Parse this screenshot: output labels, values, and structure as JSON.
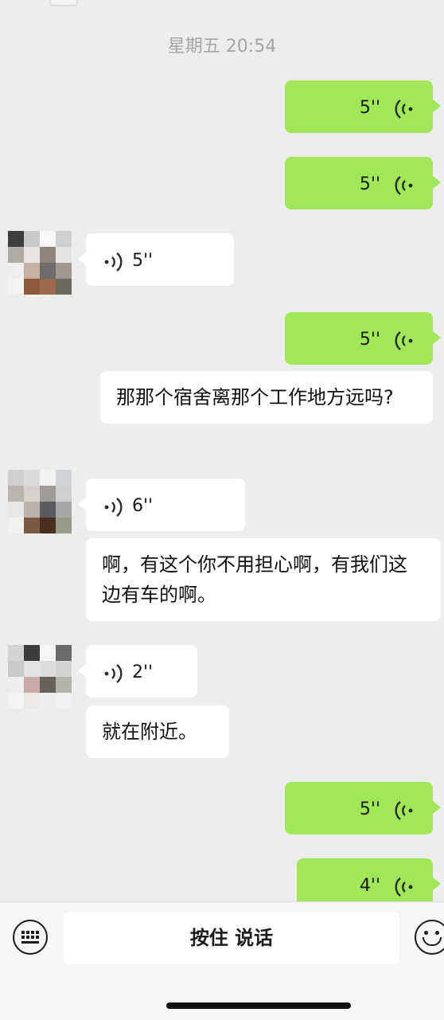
{
  "timestamp": "星期五 20:54",
  "colors": {
    "outgoing_bubble": "#a0e75a",
    "incoming_bubble": "#ffffff",
    "background": "#ededed"
  },
  "messages": [
    {
      "side": "out",
      "type": "voice",
      "duration": "5''"
    },
    {
      "side": "out",
      "type": "voice",
      "duration": "5''"
    },
    {
      "side": "in",
      "type": "voice",
      "duration": "5''"
    },
    {
      "side": "out",
      "type": "voice",
      "duration": "5''"
    },
    {
      "side": "in",
      "type": "text",
      "text": "那那个宿舍离那个工作地方远吗?"
    },
    {
      "side": "in",
      "type": "voice",
      "duration": "6''"
    },
    {
      "side": "in",
      "type": "text",
      "text": "啊，有这个你不用担心啊，有我们这边有车的啊。"
    },
    {
      "side": "in",
      "type": "voice",
      "duration": "2''"
    },
    {
      "side": "in",
      "type": "text",
      "text": "就在附近。"
    },
    {
      "side": "out",
      "type": "voice",
      "duration": "5''"
    },
    {
      "side": "out",
      "type": "voice",
      "duration": "4''"
    }
  ],
  "input_bar": {
    "hold_to_talk_label": "按住 说话",
    "left_icon": "keyboard-icon",
    "right_icon": "emoji-icon"
  }
}
